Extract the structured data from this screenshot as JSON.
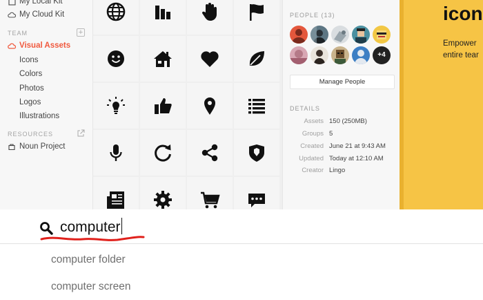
{
  "sidebar": {
    "kits": [
      {
        "label": "My Local Kit"
      },
      {
        "label": "My Cloud Kit"
      }
    ],
    "team_section": "TEAM",
    "active_item": "Visual Assets",
    "sub_items": [
      "Icons",
      "Colors",
      "Photos",
      "Logos",
      "Illustrations"
    ],
    "resources_section": "RESOURCES",
    "resource_item": "Noun Project"
  },
  "icon_grid": [
    "globe-icon",
    "bar-chart-icon",
    "hand-icon",
    "flag-icon",
    "smiley-icon",
    "house-icon",
    "heart-icon",
    "leaf-icon",
    "lightbulb-icon",
    "thumbs-up-icon",
    "map-pin-icon",
    "list-icon",
    "microphone-icon",
    "refresh-icon",
    "share-icon",
    "shield-icon",
    "newspaper-icon",
    "gear-icon",
    "shopping-cart-icon",
    "chat-bubble-icon"
  ],
  "details": {
    "people_header": "PEOPLE (13)",
    "more_people": "+4",
    "manage_label": "Manage People",
    "details_header": "DETAILS",
    "rows": [
      {
        "key": "Assets",
        "value": "150 (250MB)"
      },
      {
        "key": "Groups",
        "value": "5"
      },
      {
        "key": "Created",
        "value": "June 21 at 9:43 AM"
      },
      {
        "key": "Updated",
        "value": "Today at 12:10 AM"
      },
      {
        "key": "Creator",
        "value": "Lingo"
      }
    ]
  },
  "promo": {
    "title": "icons",
    "body_line1": "Empower",
    "body_line2": "entire tear"
  },
  "search": {
    "query": "computer",
    "suggestions": [
      "computer folder",
      "computer screen"
    ]
  },
  "colors": {
    "accent": "#f0593e",
    "promo_bg": "#f6c445",
    "annotation": "#e0201b"
  }
}
